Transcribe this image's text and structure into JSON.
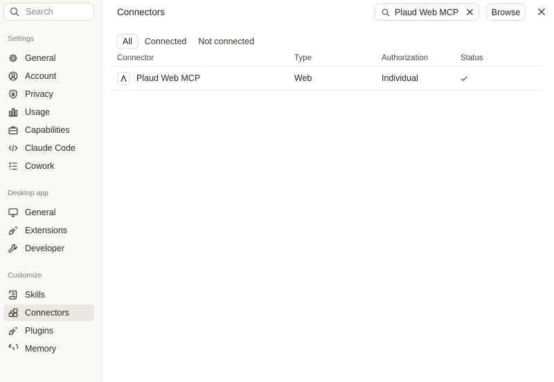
{
  "sidebar": {
    "search_placeholder": "Search",
    "sections": {
      "settings": "Settings",
      "desktop": "Desktop app",
      "customize": "Customize"
    },
    "settings_items": [
      {
        "label": "General",
        "icon": "gear-icon"
      },
      {
        "label": "Account",
        "icon": "user-circle-icon"
      },
      {
        "label": "Privacy",
        "icon": "shield-icon"
      },
      {
        "label": "Usage",
        "icon": "bar-chart-icon"
      },
      {
        "label": "Capabilities",
        "icon": "briefcase-icon"
      },
      {
        "label": "Claude Code",
        "icon": "code-icon"
      },
      {
        "label": "Cowork",
        "icon": "checklist-icon"
      }
    ],
    "desktop_items": [
      {
        "label": "General",
        "icon": "monitor-icon"
      },
      {
        "label": "Extensions",
        "icon": "plug-icon"
      },
      {
        "label": "Developer",
        "icon": "wrench-icon"
      }
    ],
    "customize_items": [
      {
        "label": "Skills",
        "icon": "scroll-icon"
      },
      {
        "label": "Connectors",
        "icon": "connectors-icon",
        "active": true
      },
      {
        "label": "Plugins",
        "icon": "plugin-icon"
      },
      {
        "label": "Memory",
        "icon": "memory-icon"
      }
    ]
  },
  "main": {
    "title": "Connectors",
    "filter_value": "Plaud Web MCP",
    "browse_label": "Browse",
    "tabs": [
      {
        "label": "All",
        "active": true
      },
      {
        "label": "Connected"
      },
      {
        "label": "Not connected"
      }
    ],
    "table": {
      "headers": {
        "connector": "Connector",
        "type": "Type",
        "authorization": "Authorization",
        "status": "Status"
      },
      "rows": [
        {
          "connector": "Plaud Web MCP",
          "logo_letter": "A",
          "type": "Web",
          "authorization": "Individual",
          "status": "check-icon"
        }
      ]
    }
  },
  "colors": {
    "accent_bg": "#ebe9e2",
    "sidebar_bg": "#faf9f6",
    "text": "#29261f"
  }
}
